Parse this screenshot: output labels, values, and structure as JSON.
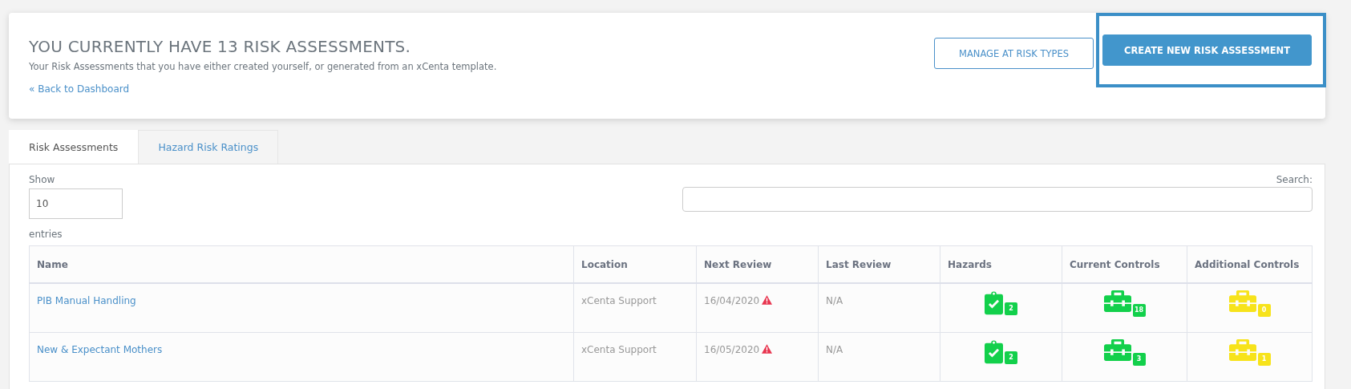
{
  "header": {
    "title": "YOU CURRENTLY HAVE 13 RISK ASSESSMENTS.",
    "subtitle": "Your Risk Assessments that you have either created yourself, or generated from an xCenta template.",
    "back_link": "« Back to Dashboard",
    "buttons": [
      {
        "label": "MANAGE AT RISK TYPES",
        "kind": "outline",
        "highlighted": false
      },
      {
        "label": "CREATE NEW RISK ASSESSMENT",
        "kind": "primary",
        "highlighted": true
      }
    ]
  },
  "tabs": [
    {
      "label": "Risk Assessments",
      "selected": true
    },
    {
      "label": "Hazard Risk Ratings",
      "selected": false
    }
  ],
  "length": {
    "label": "Show",
    "value": "10",
    "suffix": "entries"
  },
  "search": {
    "label": "Search:"
  },
  "table": {
    "columns": [
      "Name",
      "Location",
      "Next Review",
      "Last Review",
      "Hazards",
      "Current Controls",
      "Additional Controls"
    ],
    "rows": [
      {
        "name": "PIB Manual Handling",
        "location": "xCenta Support",
        "next_review": "16/04/2020",
        "overdue": true,
        "last_review": "N/A",
        "counts": [
          {
            "kind": "clipboard",
            "count": "2",
            "color": "#12d04b"
          },
          {
            "kind": "toolbox",
            "count": "18",
            "color": "#12d04b"
          },
          {
            "kind": "toolbox",
            "count": "0",
            "color": "#f7e31b"
          }
        ]
      },
      {
        "name": "New & Expectant Mothers",
        "location": "xCenta Support",
        "next_review": "16/05/2020",
        "overdue": true,
        "last_review": "N/A",
        "counts": [
          {
            "kind": "clipboard",
            "count": "2",
            "color": "#12d04b"
          },
          {
            "kind": "toolbox",
            "count": "3",
            "color": "#12d04b"
          },
          {
            "kind": "toolbox",
            "count": "1",
            "color": "#f7e31b"
          }
        ]
      }
    ]
  }
}
